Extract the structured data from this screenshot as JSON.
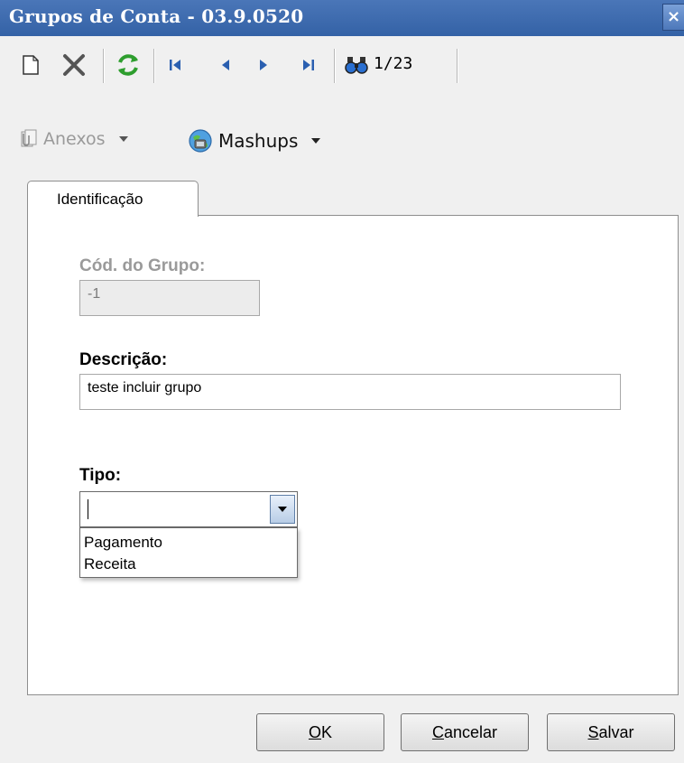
{
  "window": {
    "title": "Grupos de Conta - 03.9.0520",
    "close_glyph": "×"
  },
  "toolbar": {
    "record_counter": "1/23",
    "icons": [
      "new-icon",
      "delete-icon",
      "refresh-icon",
      "first-record-icon",
      "previous-record-icon",
      "next-record-icon",
      "last-record-icon",
      "find-icon"
    ]
  },
  "links": {
    "anexos_label": "Anexos",
    "mashups_label": "Mashups"
  },
  "tabs": [
    {
      "label": "Identificação"
    }
  ],
  "form": {
    "cod_grupo": {
      "label": "Cód. do Grupo:",
      "value": "-1"
    },
    "descricao": {
      "label": "Descrição:",
      "value": "teste incluir grupo"
    },
    "tipo": {
      "label": "Tipo:",
      "value": "",
      "options": [
        "Pagamento",
        "Receita"
      ]
    }
  },
  "buttons": {
    "ok": {
      "accel": "O",
      "rest": "K"
    },
    "cancelar": {
      "accel": "C",
      "rest": "ancelar"
    },
    "salvar": {
      "accel": "S",
      "rest": "alvar"
    }
  },
  "colors": {
    "titlebar": "#3a68ad",
    "refresh": "#2e9e2e",
    "nav": "#2a5fb0",
    "delete": "#555555",
    "disabled_text": "#9a9a9a"
  }
}
